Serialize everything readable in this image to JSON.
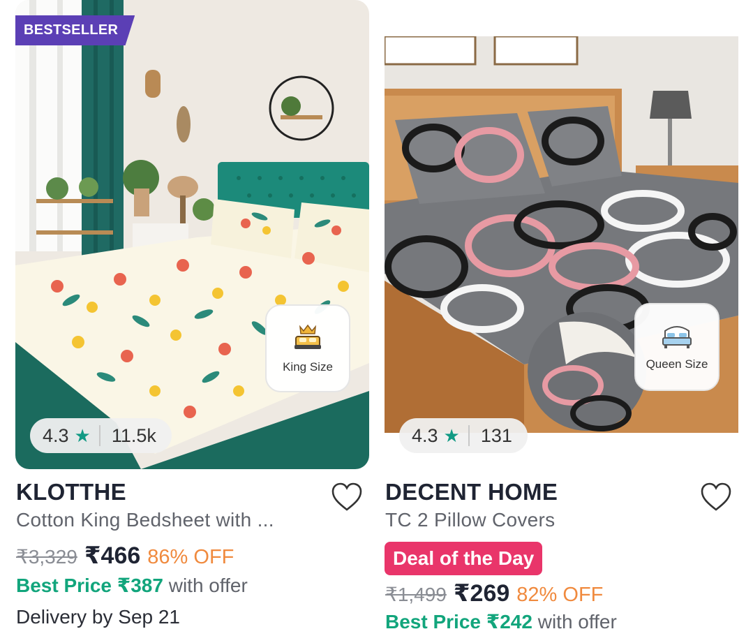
{
  "products": [
    {
      "badge": "BESTSELLER",
      "size_label": "King Size",
      "rating": "4.3",
      "reviews": "11.5k",
      "brand": "KLOTTHE",
      "description": "Cotton King Bedsheet with ...",
      "mrp": "₹3,329",
      "price": "₹466",
      "discount": "86% OFF",
      "best_price_label": "Best Price ₹387",
      "best_price_suffix": " with offer",
      "delivery": "Delivery by Sep 21"
    },
    {
      "size_label": "Queen Size",
      "rating": "4.3",
      "reviews": "131",
      "brand": "DECENT HOME",
      "description": "TC 2 Pillow Covers",
      "deal_badge": "Deal of the Day",
      "mrp": "₹1,499",
      "price": "₹269",
      "discount": "82% OFF",
      "best_price_label": "Best Price ₹242",
      "best_price_suffix": " with offer"
    }
  ],
  "colors": {
    "bestseller": "#5b3fb5",
    "star": "#119a84",
    "discount": "#f08a3e",
    "best_price": "#12a57c",
    "deal": "#e9356a"
  }
}
